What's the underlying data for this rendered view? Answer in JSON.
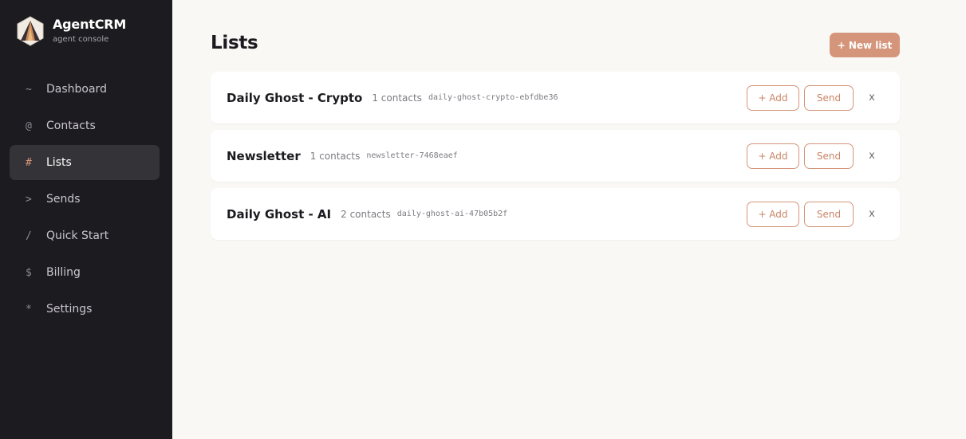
{
  "app": {
    "name": "AgentCRM",
    "subtitle": "agent console"
  },
  "colors": {
    "accent": "#d4957a",
    "sidebar_bg": "#1c1b20",
    "page_bg": "#f9f8f5"
  },
  "nav": [
    {
      "glyph": "~",
      "label": "Dashboard",
      "icon": "tilde-icon"
    },
    {
      "glyph": "@",
      "label": "Contacts",
      "icon": "at-icon"
    },
    {
      "glyph": "#",
      "label": "Lists",
      "icon": "hash-icon",
      "active": true
    },
    {
      "glyph": ">",
      "label": "Sends",
      "icon": "chevron-right-icon"
    },
    {
      "glyph": "/",
      "label": "Quick Start",
      "icon": "slash-icon"
    },
    {
      "glyph": "$",
      "label": "Billing",
      "icon": "dollar-icon"
    },
    {
      "glyph": "*",
      "label": "Settings",
      "icon": "asterisk-icon"
    }
  ],
  "page": {
    "title": "Lists",
    "new_button": "+ New list"
  },
  "lists": [
    {
      "name": "Daily Ghost - Crypto",
      "count": "1 contacts",
      "slug": "daily-ghost-crypto-ebfdbe36",
      "add_label": "+ Add",
      "send_label": "Send",
      "delete_label": "x"
    },
    {
      "name": "Newsletter",
      "count": "1 contacts",
      "slug": "newsletter-7468eaef",
      "add_label": "+ Add",
      "send_label": "Send",
      "delete_label": "x"
    },
    {
      "name": "Daily Ghost - AI",
      "count": "2 contacts",
      "slug": "daily-ghost-ai-47b05b2f",
      "add_label": "+ Add",
      "send_label": "Send",
      "delete_label": "x"
    }
  ]
}
